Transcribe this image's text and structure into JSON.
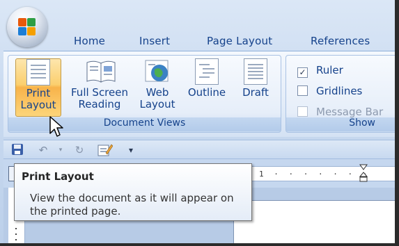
{
  "tabs": [
    {
      "label": "Home"
    },
    {
      "label": "Insert"
    },
    {
      "label": "Page Layout"
    },
    {
      "label": "References"
    }
  ],
  "groups": {
    "document_views": {
      "label": "Document Views",
      "buttons": [
        {
          "line1": "Print",
          "line2": "Layout",
          "selected": true
        },
        {
          "line1": "Full Screen",
          "line2": "Reading"
        },
        {
          "line1": "Web",
          "line2": "Layout"
        },
        {
          "line1": "Outline",
          "line2": ""
        },
        {
          "line1": "Draft",
          "line2": ""
        }
      ]
    },
    "show": {
      "label": "Show",
      "items": [
        {
          "label": "Ruler",
          "checked": true,
          "enabled": true
        },
        {
          "label": "Gridlines",
          "checked": false,
          "enabled": true
        },
        {
          "label": "Message Bar",
          "checked": false,
          "enabled": false
        }
      ]
    }
  },
  "quick_access": {
    "items": [
      "save-icon",
      "undo-icon",
      "redo-icon",
      "customize-icon",
      "dropdown-icon"
    ]
  },
  "ruler": {
    "numbers": "1 · · · · · · ·"
  },
  "tooltip": {
    "title": "Print Layout",
    "body": "View the document as it will appear on the printed page."
  },
  "colors": {
    "accent_text": "#15428b",
    "selected_button": "#f8b34a"
  }
}
